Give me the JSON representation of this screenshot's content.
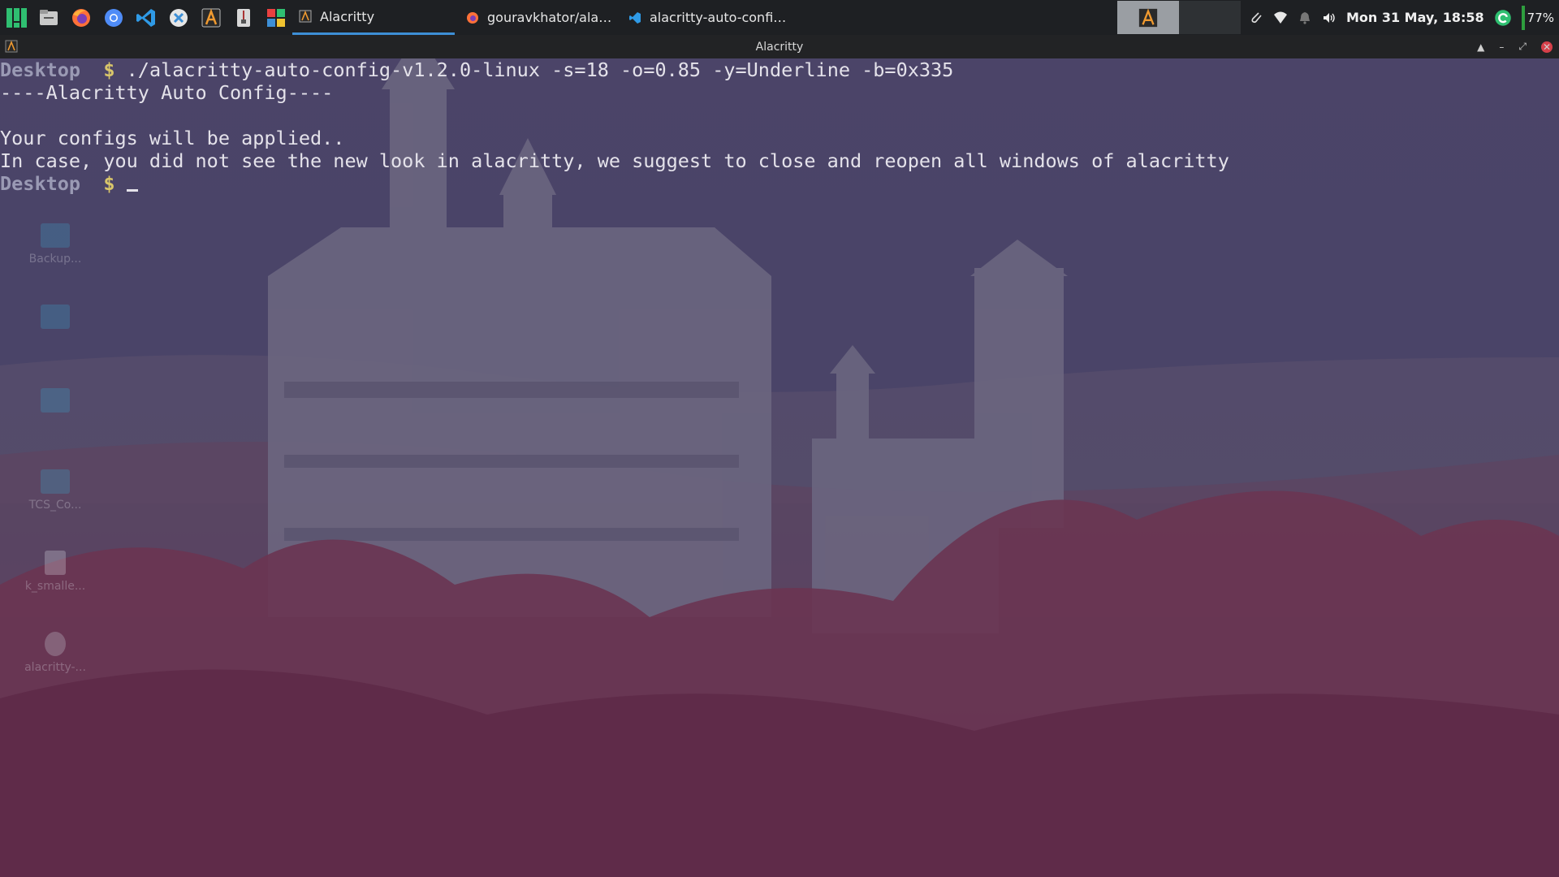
{
  "panel": {
    "launchers": [
      {
        "icon": "application-menu-icon",
        "color": "#2fbf71"
      },
      {
        "icon": "file-manager-icon",
        "color": "#c9c9c9"
      },
      {
        "icon": "firefox-icon",
        "color": "#ff7139"
      },
      {
        "icon": "chromium-icon",
        "color": "#4f8cf7"
      },
      {
        "icon": "vscode-icon",
        "color": "#2f9ae6"
      },
      {
        "icon": "kde-connect-icon",
        "color": "#e6e6e6"
      },
      {
        "icon": "alacritty-icon",
        "color": "#f09a30"
      },
      {
        "icon": "archive-manager-icon",
        "color": "#d8d8d8"
      },
      {
        "icon": "software-store-icon",
        "color": "#e94040"
      }
    ],
    "tasks": [
      {
        "label": "Alacritty",
        "icon": "alacritty-icon",
        "active": true
      },
      {
        "label": "gouravkhator/alacrit...",
        "icon": "firefox-icon",
        "active": false
      },
      {
        "label": "alacritty-auto-config ...",
        "icon": "vscode-icon",
        "active": false
      }
    ],
    "tray": {
      "clock": "Mon 31 May, 18:58",
      "battery": "77%",
      "icons": [
        "clipboard-icon",
        "wifi-icon",
        "notifications-icon",
        "volume-icon",
        "update-icon"
      ]
    }
  },
  "window": {
    "title": "Alacritty"
  },
  "terminal": {
    "prompt_dir": "Desktop",
    "prompt_sign": "$",
    "command": " ./alacritty-auto-config-v1.2.0-linux -s=18 -o=0.85 -y=Underline -b=0x335",
    "output": [
      "----Alacritty Auto Config----",
      "",
      "Your configs will be applied..",
      "In case, you did not see the new look in alacritty, we suggest to close and reopen all windows of alacritty"
    ]
  },
  "desktop_icons": [
    {
      "label": "Backup..."
    },
    {
      "label": "TCS_Co..."
    },
    {
      "label": "k_smalle..."
    },
    {
      "label": "alacritty-..."
    }
  ]
}
